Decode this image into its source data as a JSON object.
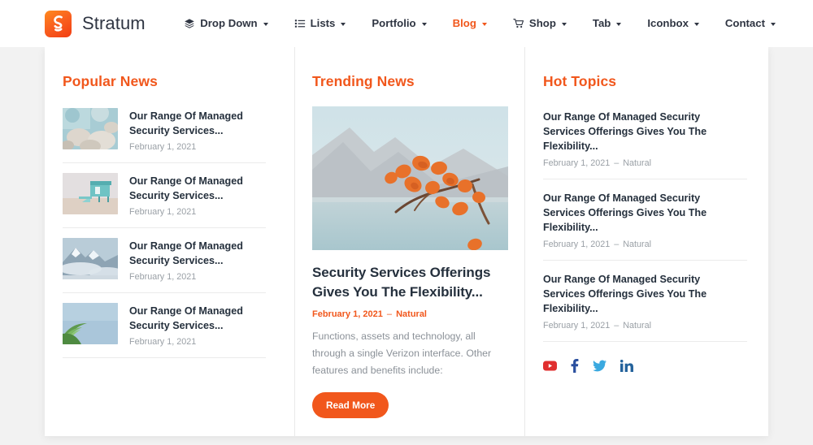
{
  "header": {
    "brand_name": "Stratum",
    "logo_icon": "stratum-s-logo",
    "nav": [
      {
        "label": "Drop Down",
        "icon": "layers-icon",
        "caret": true,
        "active": false
      },
      {
        "label": "Lists",
        "icon": "list-icon",
        "caret": true,
        "active": false
      },
      {
        "label": "Portfolio",
        "icon": null,
        "caret": true,
        "active": false
      },
      {
        "label": "Blog",
        "icon": null,
        "caret": true,
        "active": true
      },
      {
        "label": "Shop",
        "icon": "cart-icon",
        "caret": true,
        "active": false
      },
      {
        "label": "Tab",
        "icon": null,
        "caret": true,
        "active": false
      },
      {
        "label": "Iconbox",
        "icon": null,
        "caret": true,
        "active": false
      },
      {
        "label": "Contact",
        "icon": null,
        "caret": true,
        "active": false
      }
    ]
  },
  "popular_news": {
    "title": "Popular News",
    "items": [
      {
        "title": "Our Range Of Managed Security Services...",
        "date": "February 1, 2021",
        "thumb": "rocky-shore-photo"
      },
      {
        "title": "Our Range Of Managed Security Services...",
        "date": "February 1, 2021",
        "thumb": "lifeguard-tower-photo"
      },
      {
        "title": "Our Range Of Managed Security Services...",
        "date": "February 1, 2021",
        "thumb": "snowy-mountains-photo"
      },
      {
        "title": "Our Range Of Managed Security Services...",
        "date": "February 1, 2021",
        "thumb": "palm-leaves-photo"
      }
    ]
  },
  "trending_news": {
    "title": "Trending News",
    "hero_image": "orange-leaves-mountain-lake-photo",
    "post_title": "Security Services Offerings Gives You The Flexibility...",
    "date": "February 1, 2021",
    "meta_separator": "–",
    "category": "Natural",
    "excerpt": "Functions, assets and technology, all through a single Verizon interface. Other features and benefits include:",
    "read_more_label": "Read More"
  },
  "hot_topics": {
    "title": "Hot Topics",
    "items": [
      {
        "title": "Our Range Of Managed Security Services Offerings Gives You The Flexibility...",
        "date": "February 1, 2021",
        "separator": "–",
        "category": "Natural"
      },
      {
        "title": "Our Range Of Managed Security Services Offerings Gives You The Flexibility...",
        "date": "February 1, 2021",
        "separator": "–",
        "category": "Natural"
      },
      {
        "title": "Our Range Of Managed Security Services Offerings Gives You The Flexibility...",
        "date": "February 1, 2021",
        "separator": "–",
        "category": "Natural"
      }
    ],
    "socials": [
      {
        "name": "youtube-icon",
        "color": "#e02f2f"
      },
      {
        "name": "facebook-icon",
        "color": "#2a4f9e"
      },
      {
        "name": "twitter-icon",
        "color": "#3aa9e0"
      },
      {
        "name": "linkedin-icon",
        "color": "#23629b"
      }
    ]
  },
  "theme": {
    "accent": "#f1571c",
    "page_bg": "#f2f2f2",
    "card_bg": "#ffffff",
    "text_dark": "#25303d",
    "text_muted": "#9aa0a6"
  }
}
